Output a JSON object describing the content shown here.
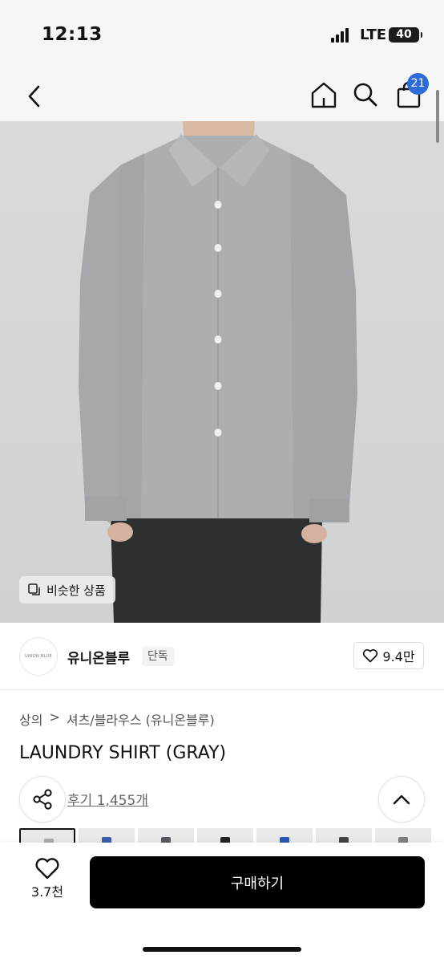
{
  "status": {
    "time": "12:13",
    "network": "LTE",
    "battery": "40"
  },
  "nav": {
    "back_icon": "chevron-left-icon",
    "home_icon": "home-icon",
    "search_icon": "search-icon",
    "bag_icon": "shopping-bag-icon",
    "cart_count": "21"
  },
  "hero": {
    "similar_label": "비슷한 상품"
  },
  "brand": {
    "logo_text": "UNION BLUE",
    "name": "유니온블루",
    "tag": "단독",
    "likes": "9.4만"
  },
  "product": {
    "breadcrumb": [
      "상의",
      ">",
      "셔츠/블라우스 (유니온블루)"
    ],
    "title": "LAUNDRY SHIRT (GRAY)",
    "reviews": "후기 1,455개"
  },
  "thumbnails": [
    {
      "accent": "#a8abad"
    },
    {
      "accent": "#3a5fb0"
    },
    {
      "accent": "#555a5e"
    },
    {
      "accent": "#222222"
    },
    {
      "accent": "#2e56b8"
    },
    {
      "accent": "#444444"
    },
    {
      "accent": "#7c7f82"
    }
  ],
  "bottom": {
    "wish_count": "3.7천",
    "buy_label": "구매하기"
  },
  "colors": {
    "badge": "#2d6bd8",
    "buy": "#000000",
    "shirt": "#a7aaac"
  }
}
